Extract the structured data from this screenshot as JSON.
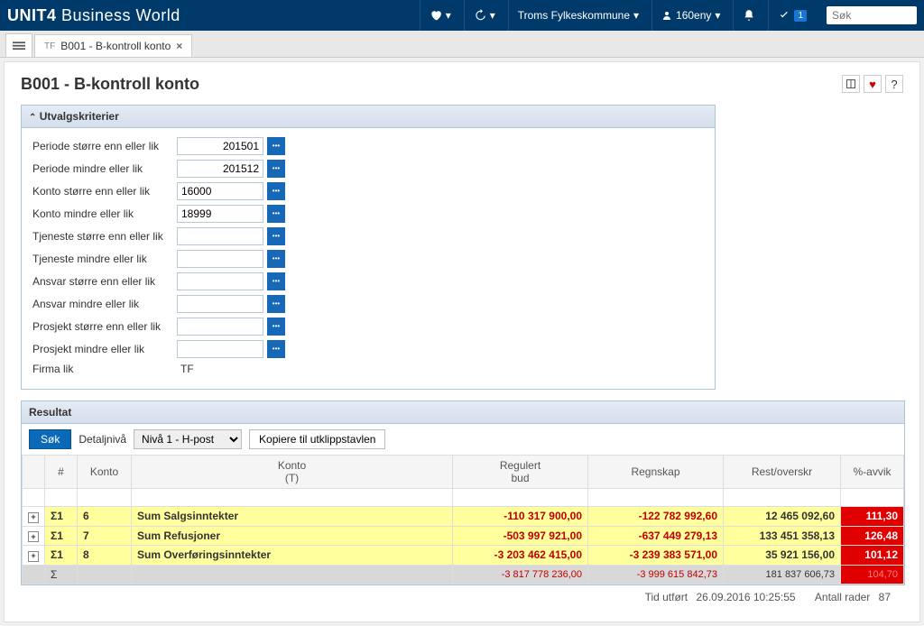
{
  "topbar": {
    "logo": "UNIT4 Business World",
    "org": "Troms Fylkeskommune",
    "user": "160eny",
    "search_placeholder": "Søk",
    "check_badge": "1"
  },
  "tab": {
    "prefix": "TF",
    "title": "B001 - B-kontroll konto"
  },
  "page_title": "B001 - B-kontroll konto",
  "criteria": {
    "title": "Utvalgskriterier",
    "rows": [
      {
        "label": "Periode større enn eller lik",
        "value": "201501",
        "num": true,
        "cal": true
      },
      {
        "label": "Periode mindre eller lik",
        "value": "201512",
        "num": true,
        "cal": true
      },
      {
        "label": "Konto større enn eller lik",
        "value": "16000",
        "num": false,
        "cal": true
      },
      {
        "label": "Konto mindre eller lik",
        "value": "18999",
        "num": false,
        "cal": true
      },
      {
        "label": "Tjeneste større enn eller lik",
        "value": "",
        "num": false,
        "cal": true
      },
      {
        "label": "Tjeneste mindre eller lik",
        "value": "",
        "num": false,
        "cal": true
      },
      {
        "label": "Ansvar større enn eller lik",
        "value": "",
        "num": false,
        "cal": true
      },
      {
        "label": "Ansvar mindre eller lik",
        "value": "",
        "num": false,
        "cal": true
      },
      {
        "label": "Prosjekt større enn eller lik",
        "value": "",
        "num": false,
        "cal": true
      },
      {
        "label": "Prosjekt mindre eller lik",
        "value": "",
        "num": false,
        "cal": true
      },
      {
        "label": "Firma lik",
        "value": "TF",
        "num": false,
        "cal": false
      }
    ]
  },
  "result": {
    "title": "Resultat",
    "btn_search": "Søk",
    "label_detalj": "Detaljnivå",
    "detalj_value": "Nivå 1 - H-post",
    "btn_copy": "Kopiere til utklippstavlen",
    "headers": {
      "num": "#",
      "konto": "Konto",
      "konto_t": "Konto\n(T)",
      "reg_bud": "Regulert\nbud",
      "regnskap": "Regnskap",
      "rest": "Rest/overskr",
      "avvik": "%-avvik"
    },
    "rows": [
      {
        "sigma": "Σ1",
        "konto": "6",
        "t": "Sum Salgsinntekter",
        "bud": "-110 317 900,00",
        "regn": "-122 782 992,60",
        "rest": "12 465 092,60",
        "avvik": "111,30"
      },
      {
        "sigma": "Σ1",
        "konto": "7",
        "t": "Sum Refusjoner",
        "bud": "-503 997 921,00",
        "regn": "-637 449 279,13",
        "rest": "133 451 358,13",
        "avvik": "126,48"
      },
      {
        "sigma": "Σ1",
        "konto": "8",
        "t": "Sum Overføringsinntekter",
        "bud": "-3 203 462 415,00",
        "regn": "-3 239 383 571,00",
        "rest": "35 921 156,00",
        "avvik": "101,12"
      }
    ],
    "total": {
      "sigma": "Σ",
      "bud": "-3 817 778 236,00",
      "regn": "-3 999 615 842,73",
      "rest": "181 837 606,73",
      "avvik": "104,70"
    }
  },
  "status": {
    "time_label": "Tid utført",
    "time_value": "26.09.2016 10:25:55",
    "rows_label": "Antall rader",
    "rows_value": "87"
  }
}
